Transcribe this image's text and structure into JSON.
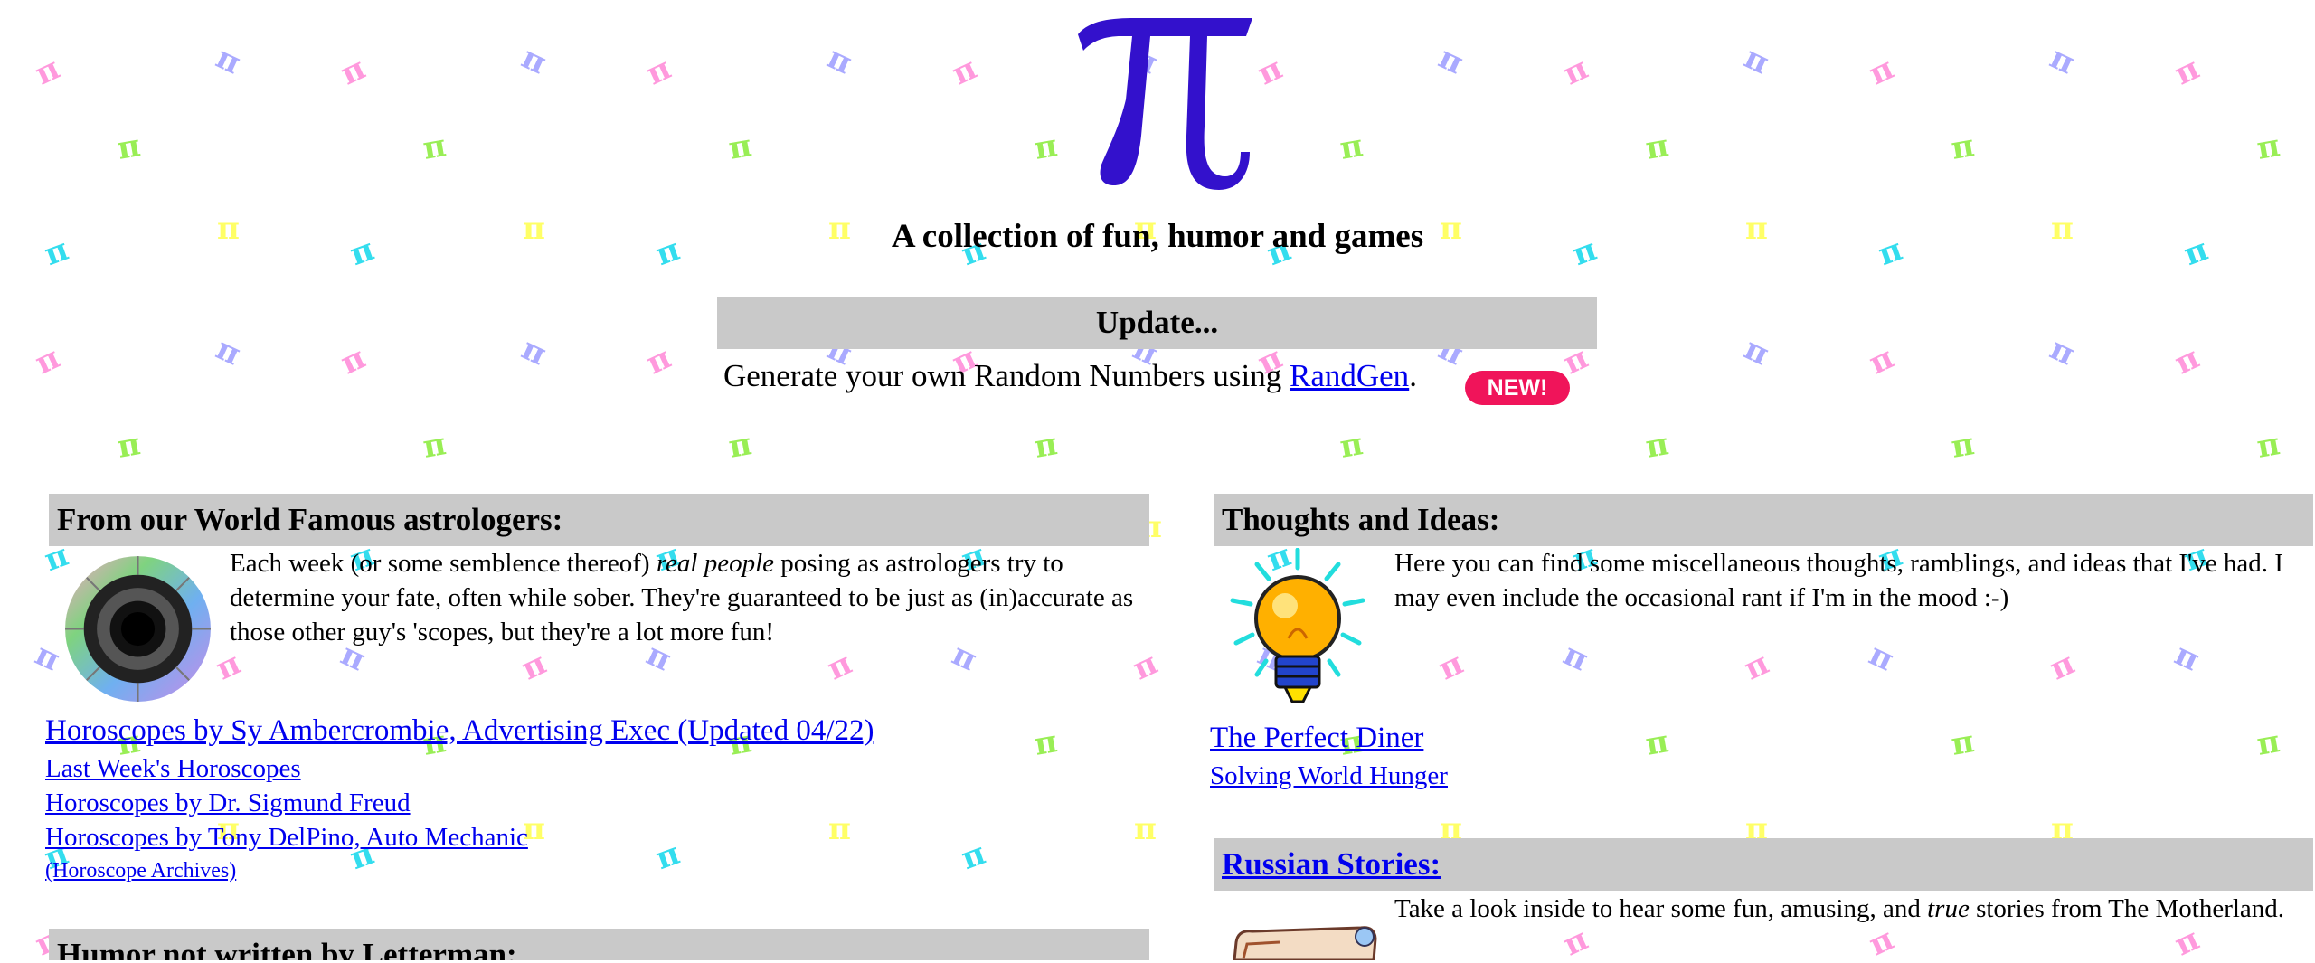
{
  "header": {
    "logo_glyph": "π",
    "tagline": "A collection of fun, humor and games"
  },
  "update": {
    "heading": "Update...",
    "text": "Generate your own Random Numbers using",
    "link": "RandGen",
    "after": ".",
    "badge": "NEW!"
  },
  "astrologers": {
    "heading": "From our World Famous astrologers:",
    "intro_before": "Each week (or some semblence thereof) ",
    "intro_em": "real people",
    "intro_after": " posing as astrologers try to determine your fate, often while sober. They're guaranteed to be just as (in)accurate as those other guy's 'scopes, but they're a lot more fun!",
    "links": [
      "Horoscopes by Sy Ambercrombie, Advertising Exec (Updated 04/22)",
      "Last Week's Horoscopes",
      "Horoscopes by Dr. Sigmund Freud",
      "Horoscopes by Tony DelPino, Auto Mechanic",
      "(Horoscope Archives)"
    ]
  },
  "humor": {
    "heading": "Humor not written by Letterman:"
  },
  "thoughts": {
    "heading": "Thoughts and Ideas:",
    "intro": "Here you can find some miscellaneous thoughts, ramblings, and ideas that I've had. I may even include the occasional rant if I'm in the mood :-)",
    "links": [
      "The Perfect Diner",
      "Solving World Hunger"
    ]
  },
  "russian": {
    "heading": "Russian Stories:",
    "intro_before": "Take a look inside to hear some fun, amusing, and ",
    "intro_em": "true",
    "intro_after": " stories from The Motherland."
  },
  "colors": {
    "section_bg": "#c9c9c9",
    "link": "#0000ee",
    "logo": "#3311cc",
    "badge": "#f0145a",
    "bg_pi": [
      "#ff99dd",
      "#aaaaff",
      "#99ee55",
      "#33ddee",
      "#ffff66"
    ]
  },
  "icons": [
    "pi-logo-icon",
    "zodiac-wheel-icon",
    "lightbulb-icon",
    "scroll-icon",
    "pi-pattern-icon"
  ]
}
